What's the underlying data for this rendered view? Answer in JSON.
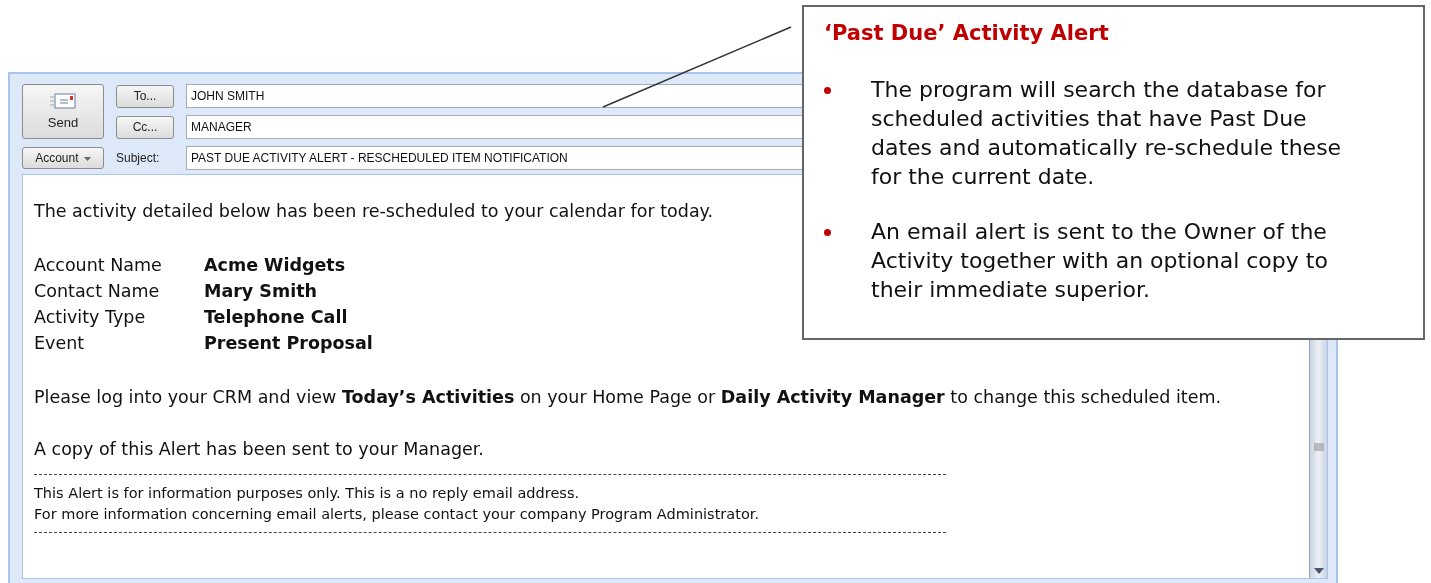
{
  "compose": {
    "send_button": "Send",
    "account_button": "Account",
    "subject_label": "Subject:",
    "recipients": [
      {
        "button": "To...",
        "value": "JOHN SMITH"
      },
      {
        "button": "Cc...",
        "value": "MANAGER"
      }
    ],
    "subject": "PAST DUE ACTIVITY ALERT - RESCHEDULED ITEM NOTIFICATION"
  },
  "body": {
    "intro": "The activity detailed below has been re-scheduled to your calendar for today.",
    "details": [
      {
        "label": "Account Name",
        "value": "Acme Widgets"
      },
      {
        "label": "Contact Name",
        "value": "Mary Smith"
      },
      {
        "label": "Activity Type",
        "value": "Telephone Call"
      },
      {
        "label": "Event",
        "value": "Present Proposal"
      }
    ],
    "instruction": "Please log into your CRM and view **Today’s Activities** on your Home Page or **Daily Activity Manager** to change this scheduled item.",
    "copy_note": "A copy of this Alert has been sent to your Manager.",
    "footer": [
      "This Alert is for information purposes only. This is a no reply email address.",
      "For more information concerning email alerts, please contact your company Program Administrator."
    ]
  },
  "callout": {
    "title": "‘Past Due’ Activity Alert",
    "bullets": [
      "The program will search the database for scheduled activities that have Past Due dates and automatically re-schedule these for the current date.",
      "An email alert is sent to the Owner of the Activity together with an optional copy to their immediate superior."
    ]
  }
}
